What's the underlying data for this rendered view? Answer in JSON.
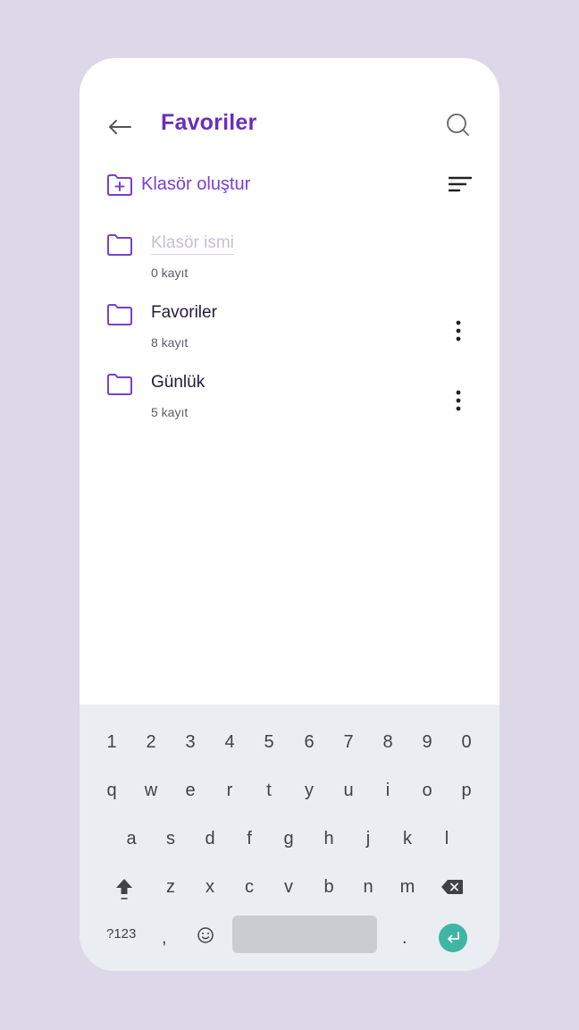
{
  "header": {
    "title": "Favoriler",
    "back_icon": "arrow-left-icon",
    "search_icon": "search-icon"
  },
  "toolbar": {
    "create_label": "Klasör oluştur",
    "create_icon": "folder-plus-icon",
    "sort_icon": "sort-icon"
  },
  "folders": [
    {
      "name": "Klasör ismi",
      "count": "0 kayıt",
      "editing": true
    },
    {
      "name": "Favoriler",
      "count": "8 kayıt",
      "editing": false
    },
    {
      "name": "Günlük",
      "count": "5 kayıt",
      "editing": false
    }
  ],
  "keyboard": {
    "row_numbers": [
      "1",
      "2",
      "3",
      "4",
      "5",
      "6",
      "7",
      "8",
      "9",
      "0"
    ],
    "row_q": [
      "q",
      "w",
      "e",
      "r",
      "t",
      "y",
      "u",
      "i",
      "o",
      "p"
    ],
    "row_a": [
      "a",
      "s",
      "d",
      "f",
      "g",
      "h",
      "j",
      "k",
      "l"
    ],
    "row_z": [
      "z",
      "x",
      "c",
      "v",
      "b",
      "n",
      "m"
    ],
    "symbols_label": "?123",
    "comma": ",",
    "period": ".",
    "emoji_icon": "emoji-icon",
    "shift_icon": "shift-icon",
    "backspace_icon": "backspace-icon",
    "enter_icon": "enter-icon"
  },
  "colors": {
    "accent": "#7a3fd4",
    "title": "#6a2dc0",
    "background": "#dcd8e8",
    "keyboard_bg": "#eaedf1",
    "enter_key": "#3fb5a3"
  }
}
